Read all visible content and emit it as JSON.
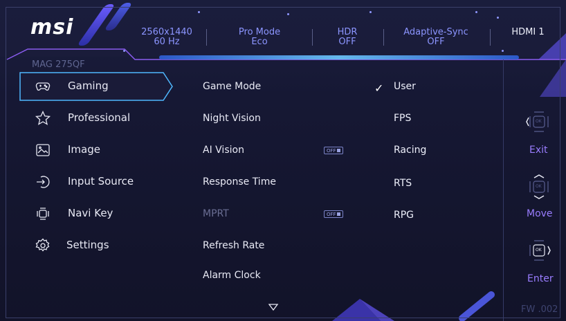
{
  "brand": "msi",
  "header": {
    "status": [
      {
        "line1": "2560x1440",
        "line2": "60 Hz"
      },
      {
        "line1": "Pro Mode",
        "line2": "Eco"
      },
      {
        "line1": "HDR",
        "line2": "OFF"
      },
      {
        "line1": "Adaptive-Sync",
        "line2": "OFF"
      },
      {
        "line1": "HDMI 1",
        "line2": ""
      }
    ]
  },
  "model": "MAG 275QF",
  "sidebar": {
    "items": [
      {
        "label": "Gaming",
        "icon": "gamepad-icon",
        "active": true
      },
      {
        "label": "Professional",
        "icon": "star-icon"
      },
      {
        "label": "Image",
        "icon": "image-icon"
      },
      {
        "label": "Input Source",
        "icon": "input-source-icon"
      },
      {
        "label": "Navi Key",
        "icon": "navi-key-icon"
      },
      {
        "label": "Settings",
        "icon": "gear-icon"
      }
    ]
  },
  "middle": {
    "items": [
      {
        "label": "Game Mode"
      },
      {
        "label": "Night Vision"
      },
      {
        "label": "AI Vision",
        "badge": "OFF"
      },
      {
        "label": "Response Time"
      },
      {
        "label": "MPRT",
        "badge": "OFF",
        "disabled": true
      },
      {
        "label": "Refresh Rate"
      },
      {
        "label": "Alarm Clock"
      }
    ]
  },
  "game_modes": {
    "selected": "User",
    "items": [
      "User",
      "FPS",
      "Racing",
      "RTS",
      "RPG"
    ]
  },
  "nav": {
    "exit": "Exit",
    "move": "Move",
    "enter": "Enter",
    "ok": "OK"
  },
  "firmware": "FW .002",
  "colors": {
    "accent": "#8c95ff",
    "active_border": "#4fb8ff",
    "purple": "#9a7dff"
  }
}
